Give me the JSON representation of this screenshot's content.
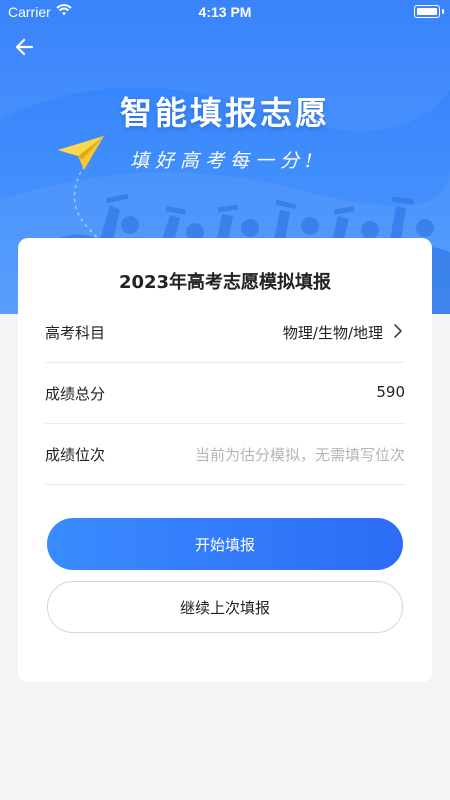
{
  "status_bar": {
    "carrier": "Carrier",
    "time": "4:13 PM"
  },
  "hero": {
    "title": "智能填报志愿",
    "slogan": "填好高考每一分!"
  },
  "card": {
    "title": "2023年高考志愿模拟填报",
    "rows": [
      {
        "label": "高考科目",
        "value": "物理/生物/地理"
      },
      {
        "label": "成绩总分",
        "value": "590"
      },
      {
        "label": "成绩位次",
        "placeholder": "当前为估分模拟，无需填写位次"
      }
    ],
    "primary_button": "开始填报",
    "secondary_button": "继续上次填报"
  },
  "colors": {
    "hero_blue": "#3d8bfc",
    "button_blue": "#2c6cf6",
    "plane_yellow": "#f5c832",
    "page_bg": "#f4f4f4"
  },
  "icons": [
    "wifi-icon",
    "battery-icon",
    "back-arrow-icon",
    "paper-plane-icon",
    "chevron-right-icon"
  ]
}
